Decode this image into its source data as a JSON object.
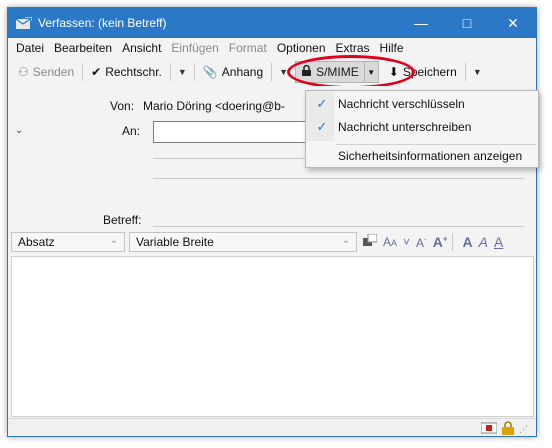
{
  "window": {
    "title": "Verfassen: (kein Betreff)",
    "controls": {
      "minimize": "—",
      "maximize": "□",
      "close": "✕"
    }
  },
  "menu": [
    {
      "label": "Datei",
      "disabled": false
    },
    {
      "label": "Bearbeiten",
      "disabled": false
    },
    {
      "label": "Ansicht",
      "disabled": false
    },
    {
      "label": "Einfügen",
      "disabled": true
    },
    {
      "label": "Format",
      "disabled": true
    },
    {
      "label": "Optionen",
      "disabled": false
    },
    {
      "label": "Extras",
      "disabled": false
    },
    {
      "label": "Hilfe",
      "disabled": false
    }
  ],
  "toolbar": {
    "send": "Senden",
    "spell": "Rechtschr.",
    "attach": "Anhang",
    "smime": "S/MIME",
    "save": "Speichern"
  },
  "header": {
    "from_label": "Von:",
    "from_value": "Mario Döring <doering@b-",
    "to_label": "An:",
    "to_value": "",
    "subject_label": "Betreff:",
    "subject_value": ""
  },
  "format": {
    "paragraph": "Absatz",
    "font": "Variable Breite"
  },
  "smime_menu": {
    "items": [
      {
        "label": "Nachricht verschlüsseln",
        "checked": true
      },
      {
        "label": "Nachricht unterschreiben",
        "checked": true
      },
      {
        "label": "Sicherheitsinformationen anzeigen",
        "checked": false
      }
    ]
  },
  "colors": {
    "titlebar": "#2b78c6",
    "highlight_ring": "#e2001a"
  }
}
